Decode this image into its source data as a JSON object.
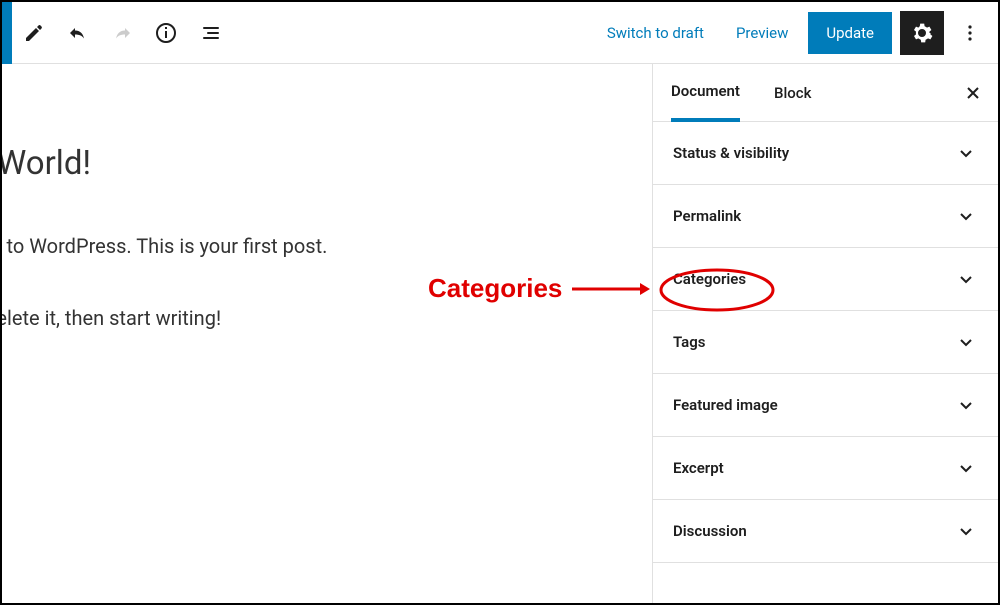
{
  "toolbar": {
    "switch_draft": "Switch to draft",
    "preview": "Preview",
    "update": "Update"
  },
  "editor": {
    "title": "lo World!",
    "para1": "ome to WordPress. This is your first post.",
    "para2": "or delete it, then start writing!"
  },
  "sidebar": {
    "tabs": {
      "document": "Document",
      "block": "Block"
    },
    "panels": {
      "status": "Status & visibility",
      "permalink": "Permalink",
      "categories": "Categories",
      "tags": "Tags",
      "featured": "Featured image",
      "excerpt": "Excerpt",
      "discussion": "Discussion"
    }
  },
  "annotation": {
    "label": "Categories"
  }
}
